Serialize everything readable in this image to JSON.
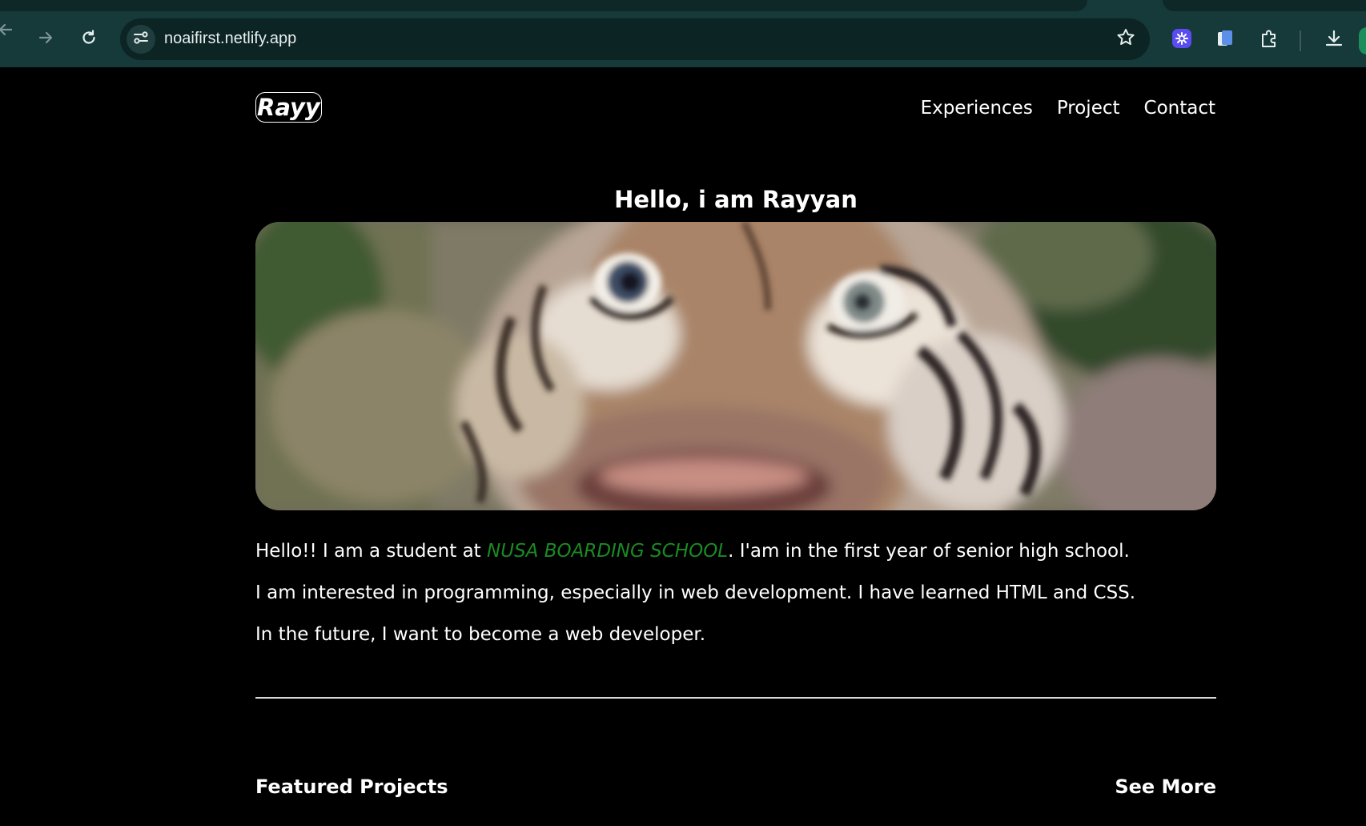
{
  "browser": {
    "url": "noaifirst.netlify.app",
    "icons": {
      "back": "arrow-left-icon",
      "forward": "arrow-right-icon",
      "reload": "reload-icon",
      "site_info": "tune-icon",
      "bookmark": "star-icon",
      "extension_1": "sparkle-extension-icon",
      "extension_2": "document-extension-icon",
      "extensions_menu": "puzzle-icon",
      "downloads": "download-icon"
    }
  },
  "header": {
    "logo": "Rayy",
    "nav": [
      "Experiences",
      "Project",
      "Contact"
    ]
  },
  "main": {
    "title": "Hello, i am Rayyan",
    "hero_image": "tiger-face-photo",
    "bio": {
      "line1_prefix": "Hello!! I am a student at ",
      "school": "NUSA BOARDING SCHOOL",
      "line1_suffix": ". I'am in the first year of senior high school.",
      "line2": "I am interested in programming, especially in web development. I have learned HTML and CSS.",
      "line3": "In the future, I want to become a web developer."
    },
    "featured_projects": {
      "title": "Featured Projects",
      "see_more": "See More"
    }
  },
  "colors": {
    "page_background": "#000000",
    "text": "#ffffff",
    "school_accent": "#1b8a23",
    "browser_chrome": "#16393a",
    "omnibox": "#0c2424"
  }
}
